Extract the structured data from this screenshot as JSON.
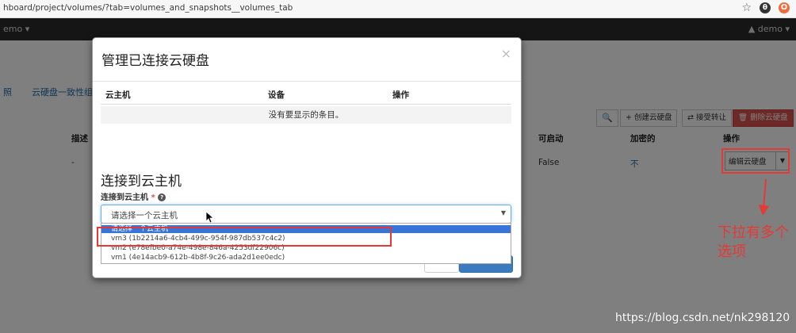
{
  "browser": {
    "url": "hboard/project/volumes/?tab=volumes_and_snapshots__volumes_tab",
    "star_icon": "star-icon",
    "account_icon": "account-icon",
    "account_glyph": "θ"
  },
  "topnav": {
    "project": "emo ▾",
    "user": "▲ demo ▾"
  },
  "background": {
    "tab_snapshots": "照",
    "tab_consistency": "云硬盘一致性组",
    "buttons": {
      "create": "+ 创建云硬盘",
      "transfer": "⇄ 接受转让",
      "delete": "🗑 删除云硬盘"
    },
    "columns": {
      "desc": "描述",
      "bootable": "可启动",
      "encrypted": "加密的",
      "actions": "操作"
    },
    "row": {
      "desc": "-",
      "bootable": "False",
      "encrypted": "不",
      "edit": "编辑云硬盘"
    }
  },
  "modal": {
    "title": "管理已连接云硬盘",
    "close": "×",
    "table": {
      "headers": {
        "instance": "云主机",
        "device": "设备",
        "actions": "操作"
      },
      "empty": "没有要显示的条目。"
    },
    "attach_title": "连接到云主机",
    "attach_label": "连接到云主机",
    "required_mark": " *",
    "select_value": "请选择一个云主机",
    "options": [
      "请选择一个云主机",
      "vm3 (1b2214a6-4cb4-499c-954f-987db537c4c2)",
      "vm2 (e78efbe0-a74e-498e-846a-4253df22906c)",
      "vm1 (4e14acb9-612b-4b8f-9c26-ada2d1ee0edc)"
    ]
  },
  "annotation": {
    "note": "下拉有多个选项",
    "color": "#e53935"
  },
  "watermark": "https://blog.csdn.net/nk298120"
}
